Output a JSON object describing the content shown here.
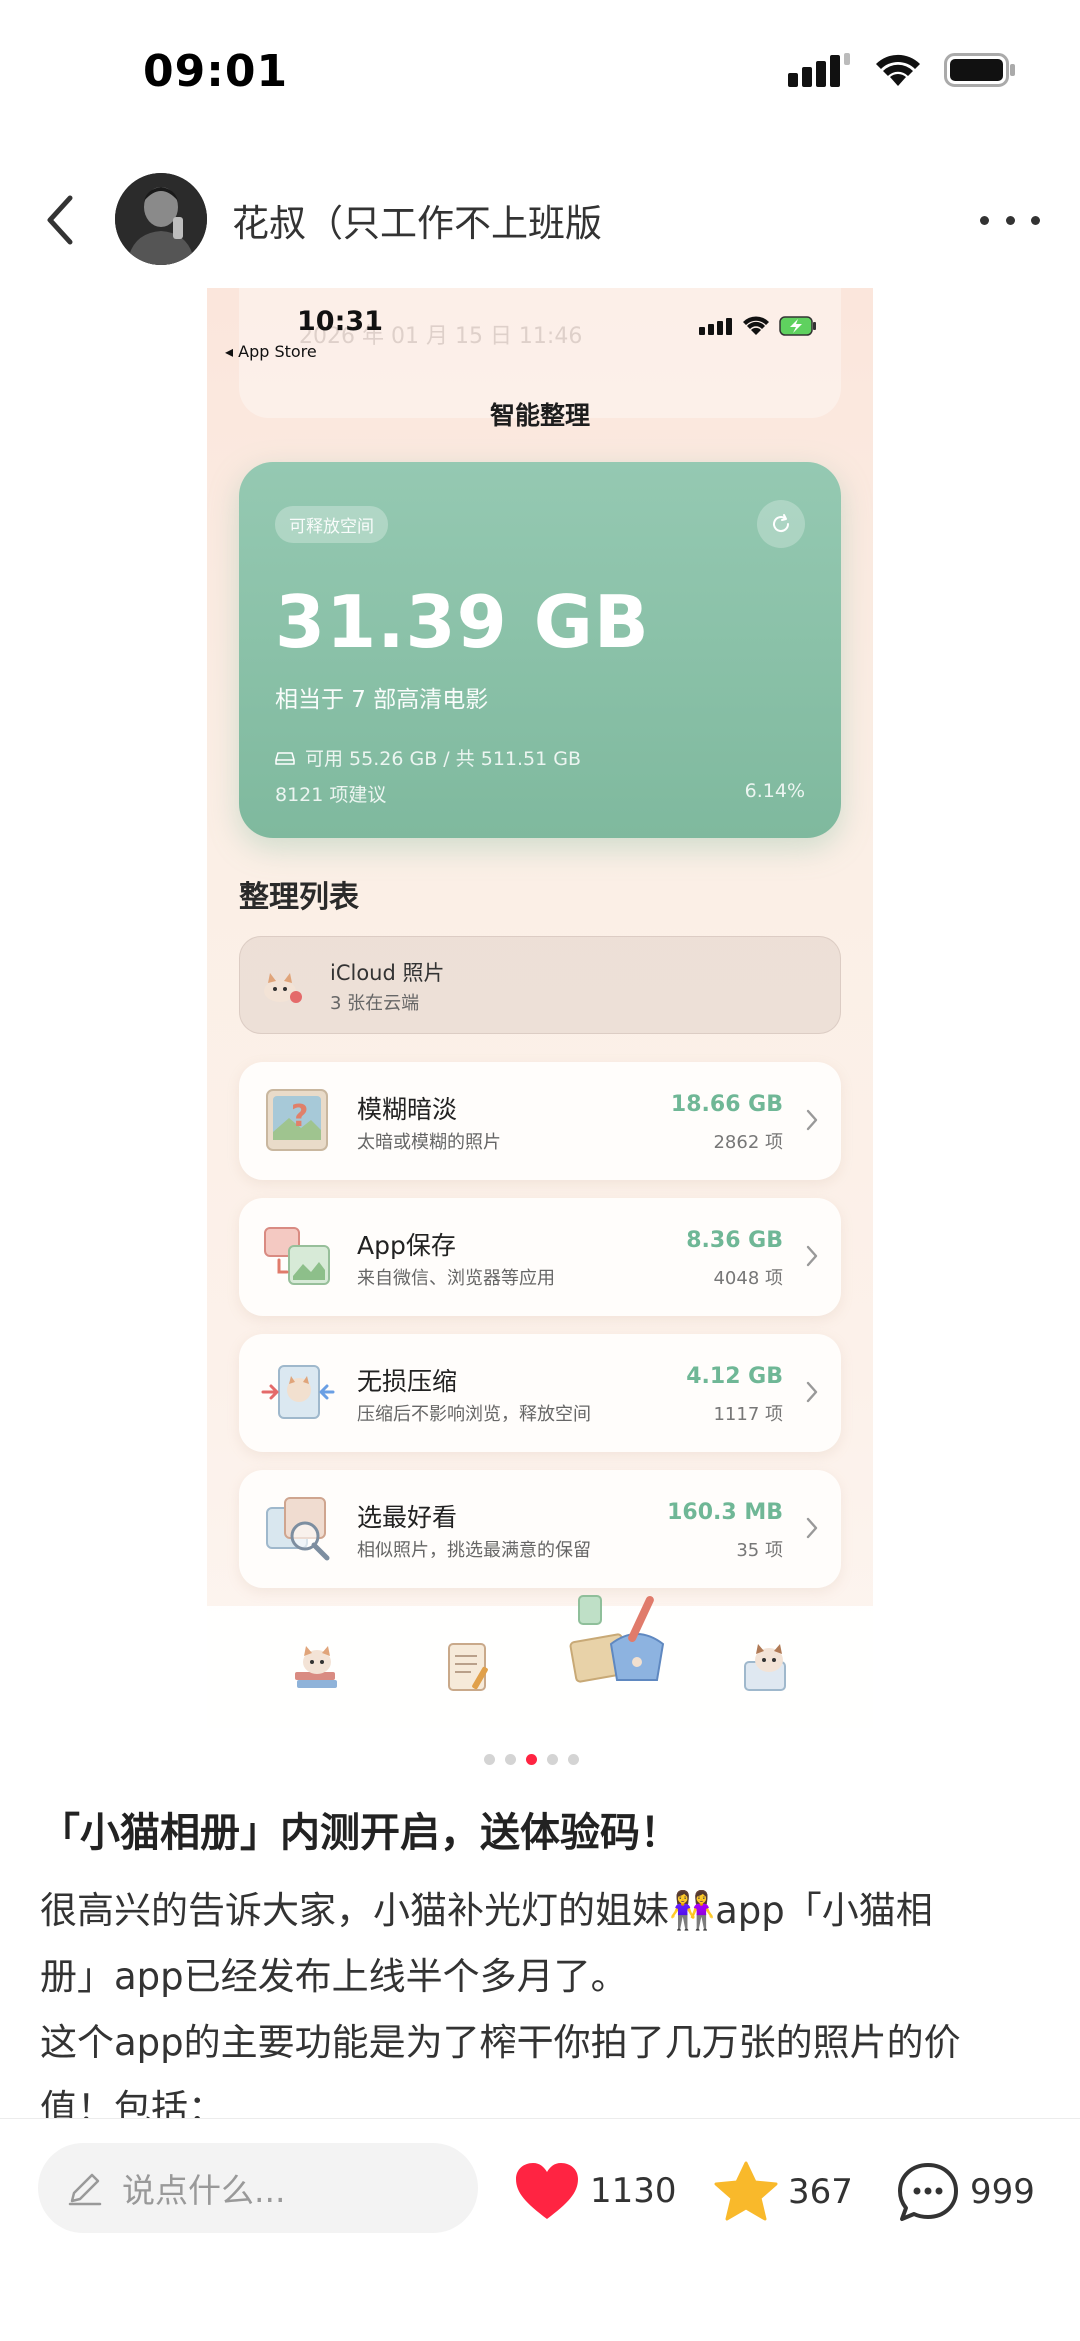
{
  "status_bar": {
    "time": "09:01"
  },
  "post": {
    "author": "花叔（只工作不上班版",
    "title": "「小猫相册」内测开启，送体验码！",
    "body_lines": [
      "很高兴的告诉大家，小猫补光灯的姐妹👭app「小猫相",
      "册」app已经发布上线半个多月了。",
      "这个app的主要功能是为了榨干你拍了几万张的照片的价",
      "值！包括："
    ]
  },
  "screenshot": {
    "status_time": "10:31",
    "back_label": "◂ App Store",
    "ghost_text": "2026 年 01 月 15 日  11:46",
    "page_title": "智能整理",
    "space_card": {
      "badge": "可释放空间",
      "amount": "31.39 GB",
      "equivalent": "相当于 7 部高清电影",
      "disk": "可用 55.26 GB / 共 511.51 GB",
      "suggestions": "8121 项建议",
      "percent": "6.14%",
      "percent_value": 6.14
    },
    "list_title": "整理列表",
    "icloud": {
      "title": "iCloud 照片",
      "subtitle": "3 张在云端"
    },
    "rows": [
      {
        "title": "模糊暗淡",
        "subtitle": "太暗或模糊的照片",
        "size": "18.66 GB",
        "count": "2862 项",
        "icon": "blurry-photo-icon"
      },
      {
        "title": "App保存",
        "subtitle": "来自微信、浏览器等应用",
        "size": "8.36 GB",
        "count": "4048 项",
        "icon": "app-saved-icon"
      },
      {
        "title": "无损压缩",
        "subtitle": "压缩后不影响浏览，释放空间",
        "size": "4.12 GB",
        "count": "1117 项",
        "icon": "compress-icon"
      },
      {
        "title": "选最好看",
        "subtitle": "相似照片，挑选最满意的保留",
        "size": "160.3 MB",
        "count": "35 项",
        "icon": "best-pick-icon"
      }
    ],
    "tabs": [
      "cat-books-tab-icon",
      "notebook-tab-icon",
      "cleanup-tab-icon",
      "cat-card-tab-icon"
    ]
  },
  "carousel": {
    "total": 5,
    "active_index": 2
  },
  "bottom_bar": {
    "comment_placeholder": "说点什么...",
    "likes": "1130",
    "favorites": "367",
    "comments": "999"
  },
  "colors": {
    "accent_red": "#ff2442",
    "card_green": "#7fb99e",
    "star_yellow": "#f9b92b"
  }
}
